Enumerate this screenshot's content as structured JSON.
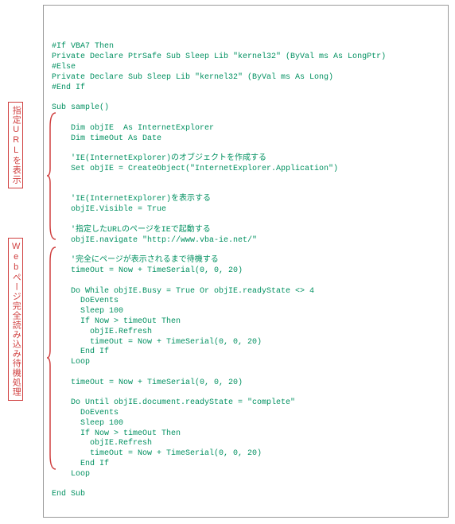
{
  "labels": {
    "top": "指定URLを表示",
    "bottom": "Webページ完全読み込み待機処理"
  },
  "code": {
    "l01": "#If VBA7 Then",
    "l02": "Private Declare PtrSafe Sub Sleep Lib \"kernel32\" (ByVal ms As LongPtr)",
    "l03": "#Else",
    "l04": "Private Declare Sub Sleep Lib \"kernel32\" (ByVal ms As Long)",
    "l05": "#End If",
    "l06": "",
    "l07": "Sub sample()",
    "l08": "",
    "l09": "    Dim objIE  As InternetExplorer",
    "l10": "    Dim timeOut As Date",
    "l11": "",
    "l12": "    'IE(InternetExplorer)のオブジェクトを作成する",
    "l13": "    Set objIE = CreateObject(\"InternetExplorer.Application\")",
    "l14": "",
    "l15": "",
    "l16": "    'IE(InternetExplorer)を表示する",
    "l17": "    objIE.Visible = True",
    "l18": "",
    "l19": "    '指定したURLのページをIEで起動する",
    "l20": "    objIE.navigate \"http://www.vba-ie.net/\"",
    "l21": "",
    "l22": "    '完全にページが表示されるまで待機する",
    "l23": "    timeOut = Now + TimeSerial(0, 0, 20)",
    "l24": "",
    "l25": "    Do While objIE.Busy = True Or objIE.readyState <> 4",
    "l26": "      DoEvents",
    "l27": "      Sleep 100",
    "l28": "      If Now > timeOut Then",
    "l29": "        objIE.Refresh",
    "l30": "        timeOut = Now + TimeSerial(0, 0, 20)",
    "l31": "      End If",
    "l32": "    Loop",
    "l33": "",
    "l34": "    timeOut = Now + TimeSerial(0, 0, 20)",
    "l35": "",
    "l36": "    Do Until objIE.document.readyState = \"complete\"",
    "l37": "      DoEvents",
    "l38": "      Sleep 100",
    "l39": "      If Now > timeOut Then",
    "l40": "        objIE.Refresh",
    "l41": "        timeOut = Now + TimeSerial(0, 0, 20)",
    "l42": "      End If",
    "l43": "    Loop",
    "l44": "",
    "l45": "End Sub"
  }
}
